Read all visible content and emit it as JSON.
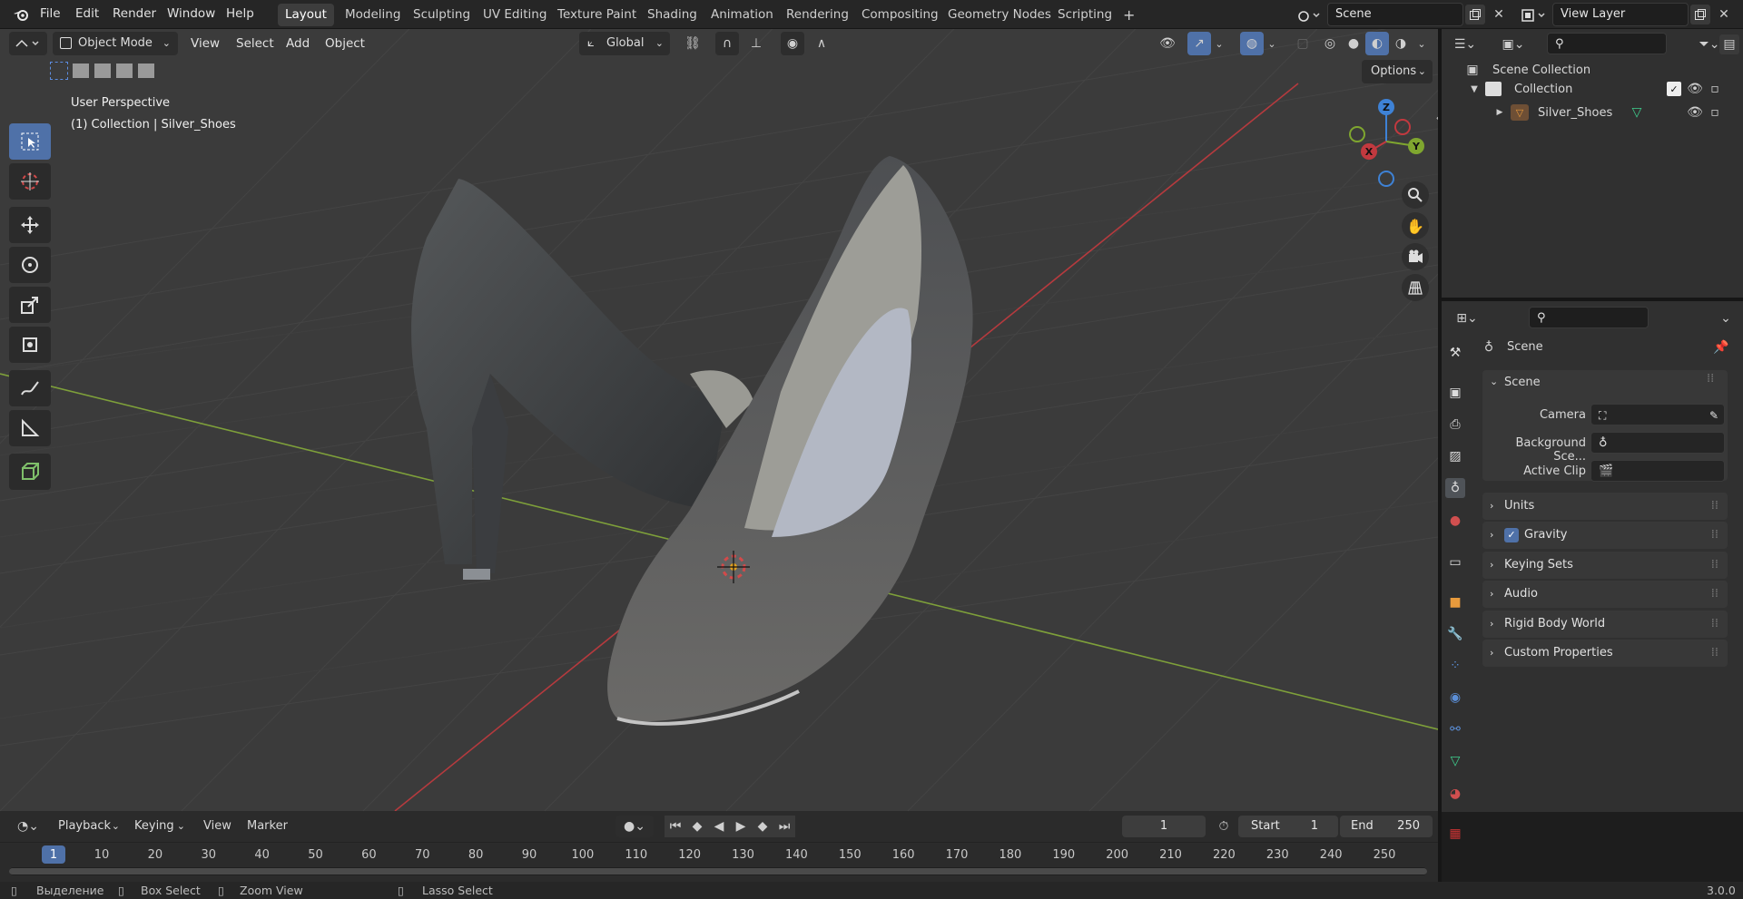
{
  "topbar": {
    "menu": [
      "File",
      "Edit",
      "Render",
      "Window",
      "Help"
    ],
    "workspaces": [
      "Layout",
      "Modeling",
      "Sculpting",
      "UV Editing",
      "Texture Paint",
      "Shading",
      "Animation",
      "Rendering",
      "Compositing",
      "Geometry Nodes",
      "Scripting"
    ],
    "active_workspace": "Layout",
    "add_tab": "+",
    "scene": "Scene",
    "view_layer": "View Layer"
  },
  "viewport_header": {
    "mode": "Object Mode",
    "menus": [
      "View",
      "Select",
      "Add",
      "Object"
    ],
    "transform_orientation": "Global",
    "options": "Options"
  },
  "viewport": {
    "perspective": "User Perspective",
    "collection_info": "(1) Collection | Silver_Shoes",
    "gizmo": {
      "z": "Z",
      "x": "X",
      "y": "Y"
    }
  },
  "outliner": {
    "root": "Scene Collection",
    "collection": "Collection",
    "object": "Silver_Shoes"
  },
  "properties": {
    "header": "Scene",
    "section": "Scene",
    "fields": {
      "camera": "Camera",
      "background": "Background Sce...",
      "active_clip": "Active Clip"
    },
    "panels": [
      "Units",
      "Gravity",
      "Keying Sets",
      "Audio",
      "Rigid Body World",
      "Custom Properties"
    ],
    "gravity_checked": true
  },
  "timeline": {
    "menus": [
      "Playback",
      "Keying",
      "View",
      "Marker"
    ],
    "current_frame": "1",
    "start_label": "Start",
    "start": "1",
    "end_label": "End",
    "end": "250",
    "ticks": [
      "1",
      "10",
      "20",
      "30",
      "40",
      "50",
      "60",
      "70",
      "80",
      "90",
      "100",
      "110",
      "120",
      "130",
      "140",
      "150",
      "160",
      "170",
      "180",
      "190",
      "200",
      "210",
      "220",
      "230",
      "240",
      "250"
    ]
  },
  "statusbar": {
    "select": "Выделение",
    "box_select": "Box Select",
    "zoom_view": "Zoom View",
    "lasso_select": "Lasso Select",
    "version": "3.0.0"
  },
  "colors": {
    "accent": "#4f71a8",
    "x_axis": "#c2393f",
    "y_axis": "#7fa62f",
    "z_axis": "#3e82d6"
  }
}
